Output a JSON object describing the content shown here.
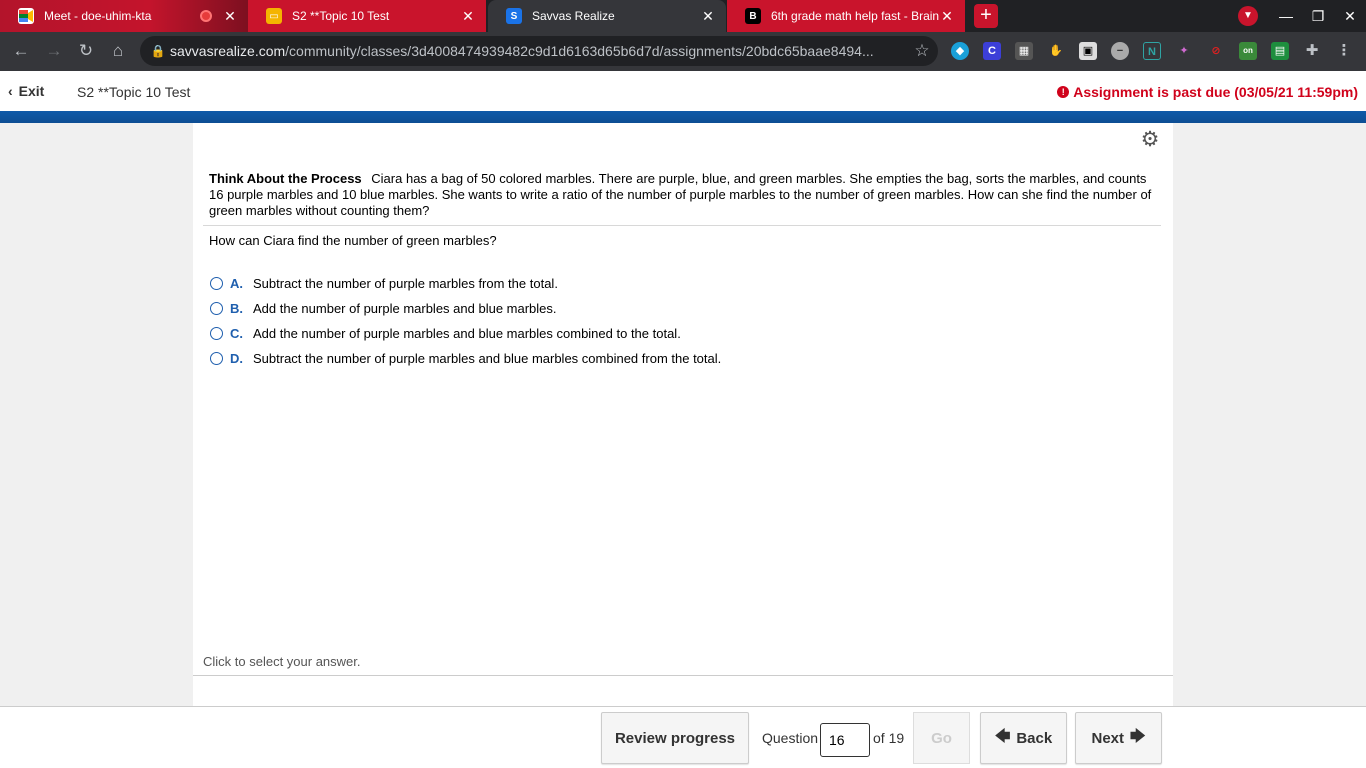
{
  "browser": {
    "tabs": [
      {
        "title": "Meet - doe-uhim-kta",
        "favicon": "google-meet-icon",
        "recording": true
      },
      {
        "title": "S2 **Topic 10 Test",
        "favicon": "slides-icon"
      },
      {
        "title": "Savvas Realize",
        "favicon": "savvas-icon",
        "active": true
      },
      {
        "title": "6th grade math help fast - Brainl",
        "favicon": "brainly-icon"
      }
    ],
    "url_host": "savvasrealize.com",
    "url_path": "/community/classes/3d4008474939482c9d1d6163d65b6d7d/assignments/20bdc65baae8494...",
    "colors": {
      "tab_red": "#c9142c",
      "chrome_dark": "#202124",
      "toolbar": "#35363a"
    }
  },
  "header": {
    "exit_label": "Exit",
    "assignment_title": "S2 **Topic 10 Test",
    "past_due": "Assignment is past due (03/05/21 11:59pm)"
  },
  "problem": {
    "heading": "Think About the Process",
    "stem": "Ciara has a bag of 50 colored marbles. There are purple, blue, and green marbles. She empties the bag, sorts the marbles, and counts 16 purple marbles and 10 blue marbles. She wants to write a ratio of the number of purple marbles to the number of green marbles. How can she find the number of green marbles without counting them?",
    "question": "How can Ciara find the number of green marbles?",
    "choices": [
      {
        "letter": "A.",
        "text": "Subtract the number of purple marbles from the total."
      },
      {
        "letter": "B.",
        "text": "Add the number of purple marbles and blue marbles."
      },
      {
        "letter": "C.",
        "text": "Add the number of purple marbles and blue marbles combined to the total."
      },
      {
        "letter": "D.",
        "text": "Subtract the number of purple marbles and blue marbles combined from the total."
      }
    ],
    "hint": "Click to select your answer."
  },
  "footer": {
    "review_label": "Review progress",
    "question_label": "Question",
    "question_number": "16",
    "of_total": "of 19",
    "go_label": "Go",
    "back_label": "Back",
    "next_label": "Next"
  }
}
